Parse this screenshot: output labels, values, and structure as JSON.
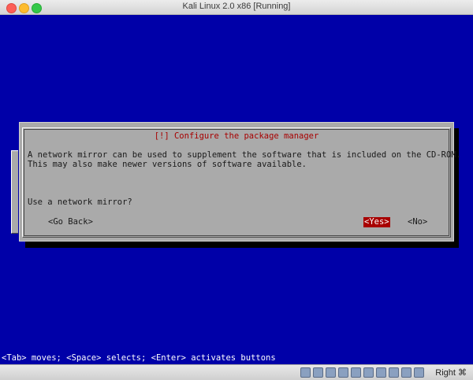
{
  "window": {
    "title": "Kali Linux 2.0 x86 [Running]"
  },
  "dialog": {
    "title": "[!] Configure the package manager",
    "body": "A network mirror can be used to supplement the software that is included on the CD-ROM.\nThis may also make newer versions of software available.",
    "question": "Use a network mirror?",
    "buttons": {
      "back": "<Go Back>",
      "yes": "<Yes>",
      "no": "<No>"
    }
  },
  "statusline": "<Tab> moves; <Space> selects; <Enter> activates buttons",
  "vbox": {
    "host_key": "Right ⌘",
    "icons": [
      "hard-disk-icon",
      "optical-drive-icon",
      "audio-icon",
      "network-icon",
      "usb-icon",
      "shared-folders-icon",
      "display-icon",
      "video-capture-icon",
      "mouse-integration-icon",
      "keyboard-icon"
    ]
  },
  "colors": {
    "screen_bg": "#0000a8",
    "dialog_bg": "#aaaaaa",
    "title_red": "#a80000",
    "selected_bg": "#a80000"
  }
}
